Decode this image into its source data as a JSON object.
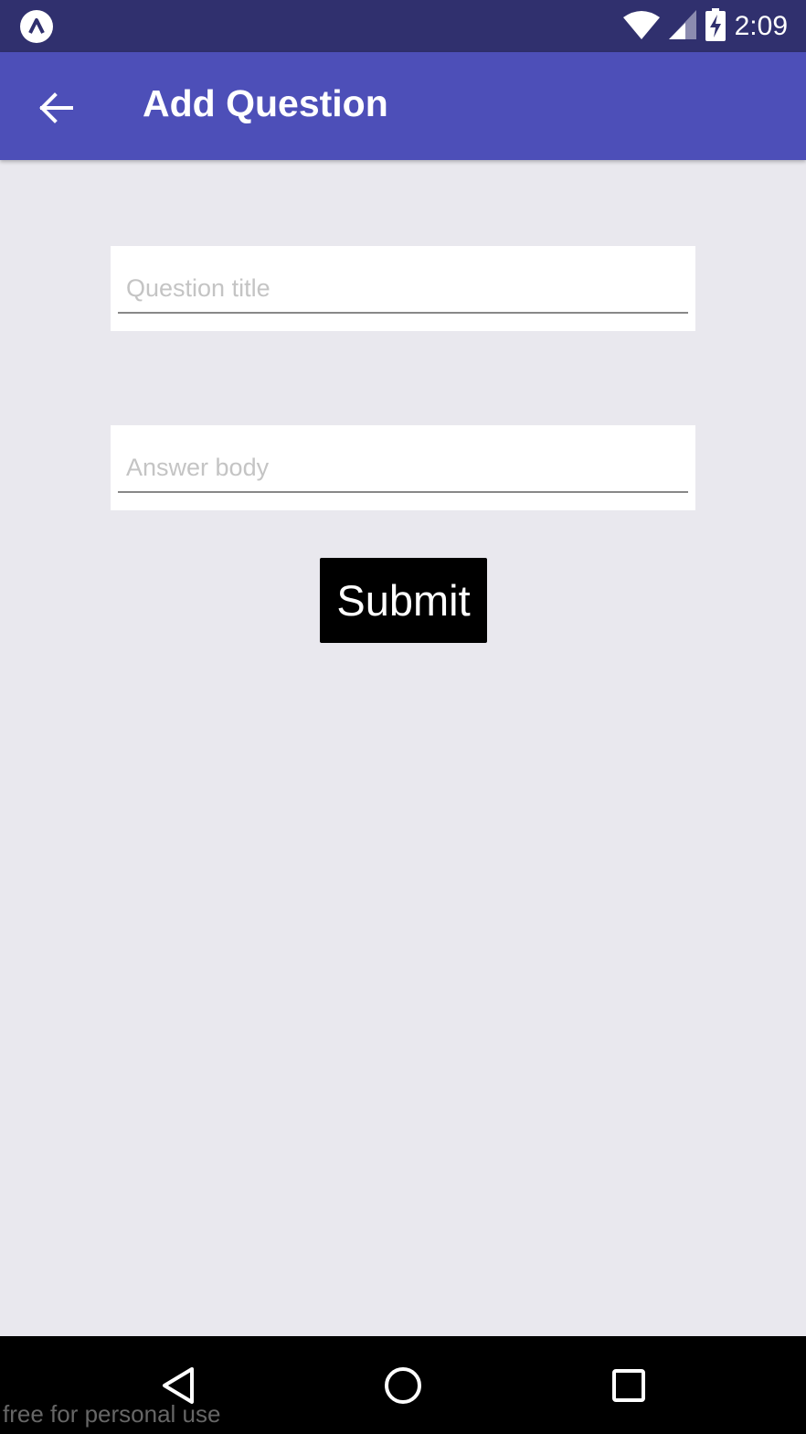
{
  "status_bar": {
    "time": "2:09",
    "icons": [
      "app-notification-icon",
      "wifi-icon",
      "cell-signal-icon",
      "battery-charging-icon"
    ]
  },
  "app_bar": {
    "title": "Add Question",
    "back_icon": "arrow-back-icon",
    "color": "#4d4fb8"
  },
  "form": {
    "question_title": {
      "placeholder": "Question title",
      "value": ""
    },
    "answer_body": {
      "placeholder": "Answer body",
      "value": ""
    },
    "submit_label": "Submit"
  },
  "nav_bar": {
    "icons": [
      "back-triangle-icon",
      "home-circle-icon",
      "recents-square-icon"
    ]
  },
  "watermark": "free for personal use",
  "colors": {
    "background": "#e9e8ee",
    "status_bar": "#30306e",
    "button": "#000000",
    "nav_bar": "#000000"
  }
}
